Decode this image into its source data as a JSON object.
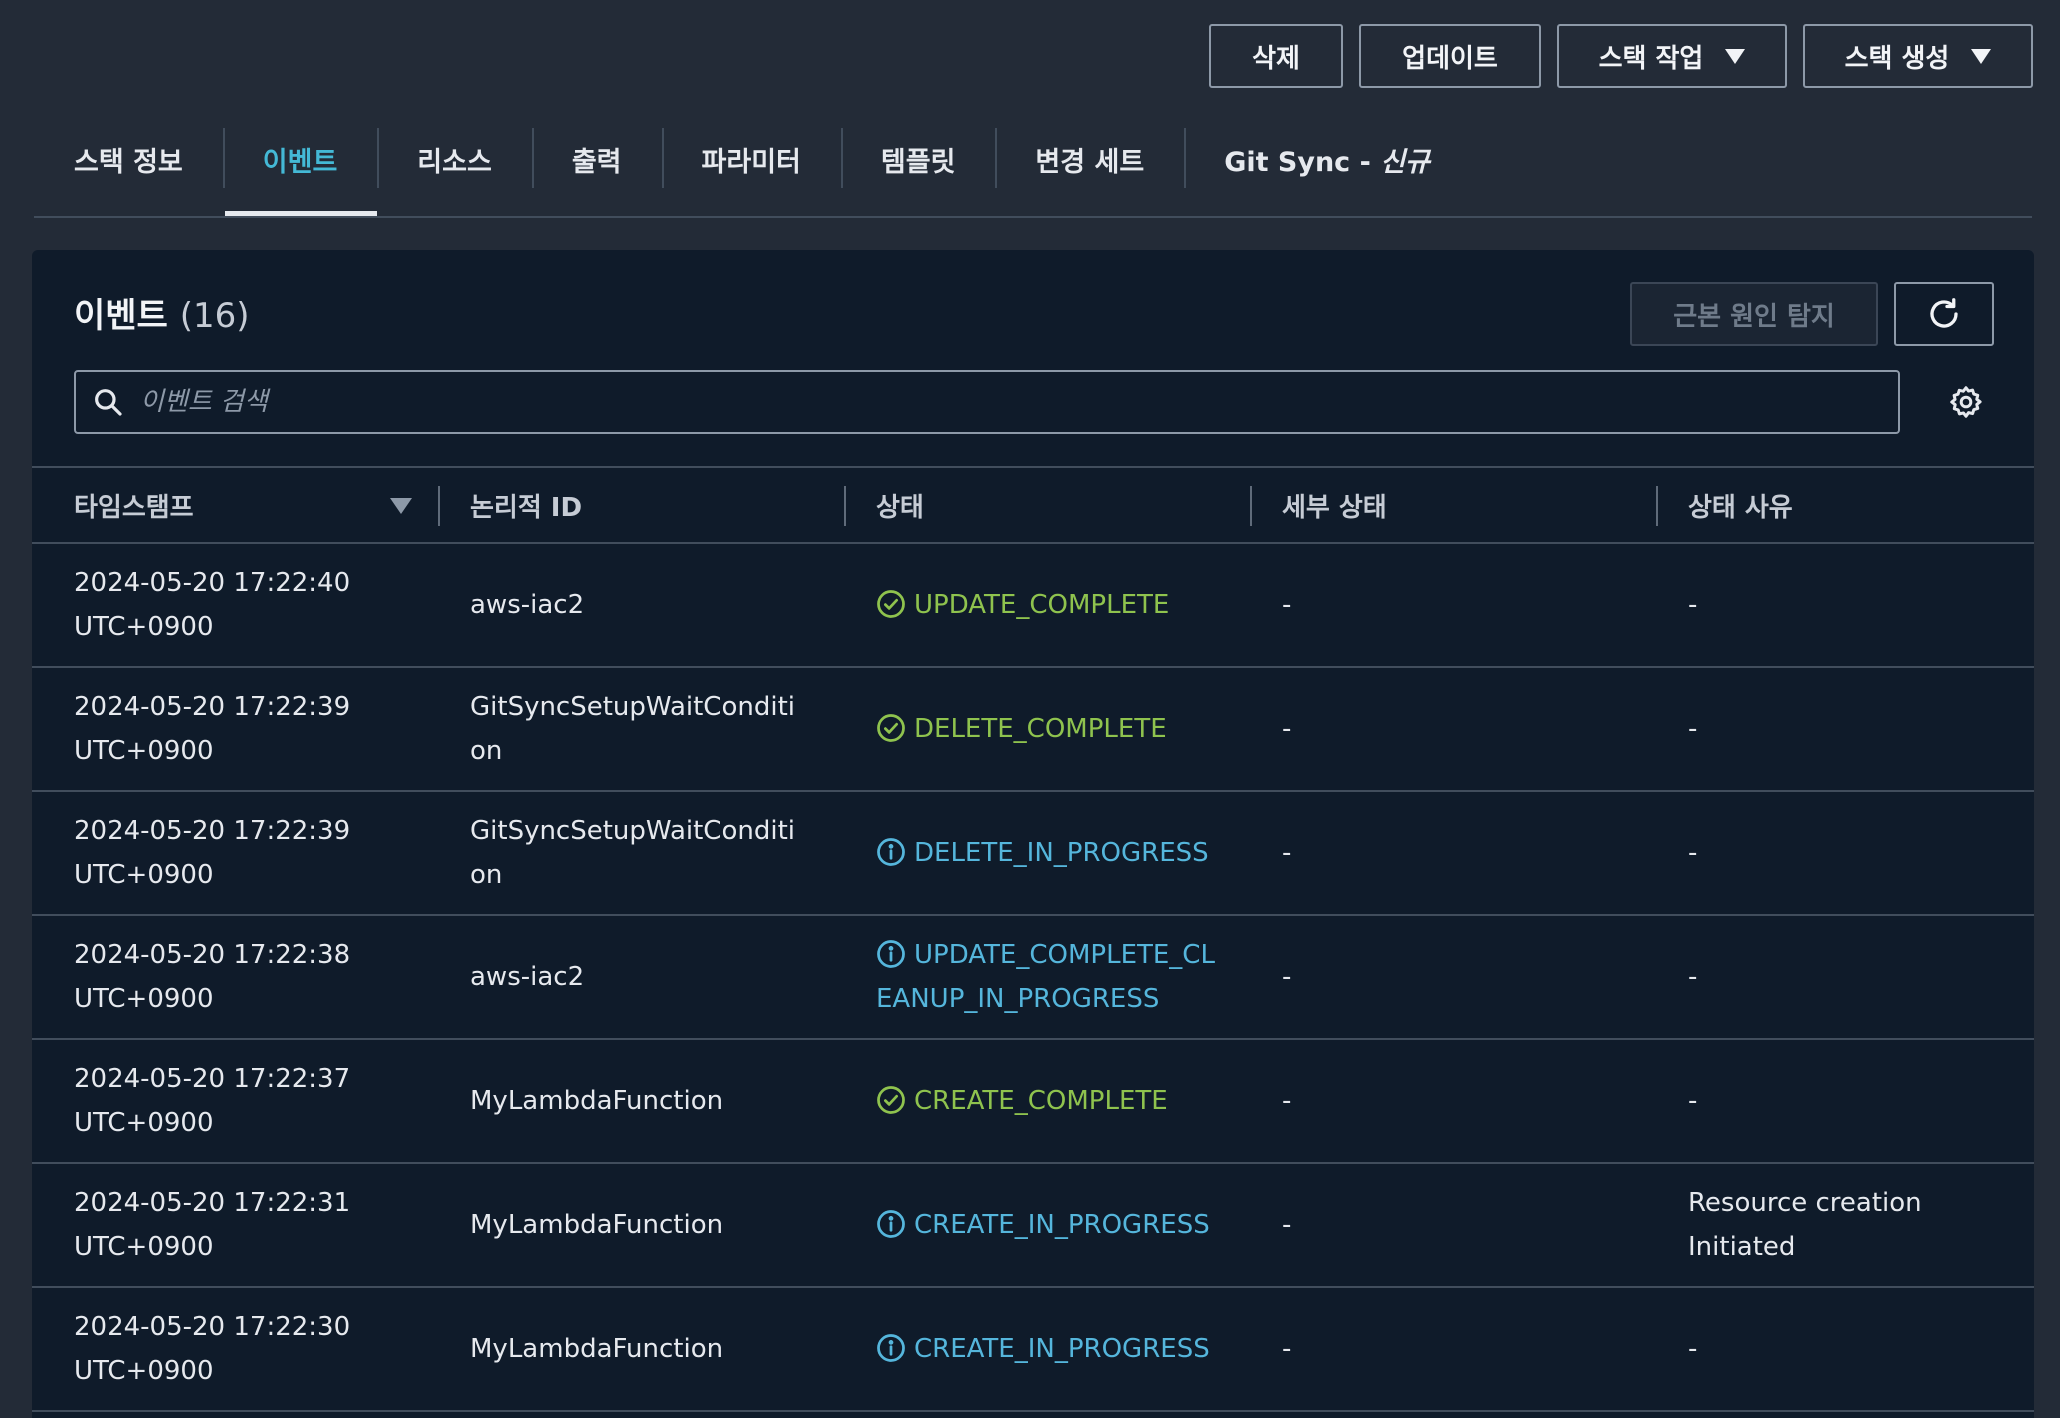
{
  "toolbar": {
    "delete_label": "삭제",
    "update_label": "업데이트",
    "stack_action_label": "스택 작업",
    "create_stack_label": "스택 생성"
  },
  "tabs": [
    {
      "label": "스택 정보",
      "active": false
    },
    {
      "label": "이벤트",
      "active": true
    },
    {
      "label": "리소스",
      "active": false
    },
    {
      "label": "출력",
      "active": false
    },
    {
      "label": "파라미터",
      "active": false
    },
    {
      "label": "템플릿",
      "active": false
    },
    {
      "label": "변경 세트",
      "active": false
    },
    {
      "label": "Git Sync - ",
      "new_label": "신규",
      "active": false
    }
  ],
  "events_panel": {
    "title": "이벤트",
    "count": "(16)",
    "rca_button_label": "근본 원인 탐지",
    "search_placeholder": "이벤트 검색"
  },
  "table": {
    "headers": {
      "timestamp": "타임스탬프",
      "logical_id": "논리적 ID",
      "status": "상태",
      "detailed_status": "세부 상태",
      "status_reason": "상태 사유"
    },
    "rows": [
      {
        "timestamp": "2024-05-20 17:22:40\nUTC+0900",
        "logical_id": "aws-iac2",
        "status": "UPDATE_COMPLETE",
        "status_type": "success",
        "detailed_status": "-",
        "status_reason": "-"
      },
      {
        "timestamp": "2024-05-20 17:22:39\nUTC+0900",
        "logical_id": "GitSyncSetupWaitCondition",
        "status": "DELETE_COMPLETE",
        "status_type": "success",
        "detailed_status": "-",
        "status_reason": "-"
      },
      {
        "timestamp": "2024-05-20 17:22:39\nUTC+0900",
        "logical_id": "GitSyncSetupWaitCondition",
        "status": "DELETE_IN_PROGRESS",
        "status_type": "info",
        "detailed_status": "-",
        "status_reason": "-"
      },
      {
        "timestamp": "2024-05-20 17:22:38\nUTC+0900",
        "logical_id": "aws-iac2",
        "status": "UPDATE_COMPLETE_CLEANUP_IN_PROGRESS",
        "status_type": "info",
        "detailed_status": "-",
        "status_reason": "-"
      },
      {
        "timestamp": "2024-05-20 17:22:37\nUTC+0900",
        "logical_id": "MyLambdaFunction",
        "status": "CREATE_COMPLETE",
        "status_type": "success",
        "detailed_status": "-",
        "status_reason": "-"
      },
      {
        "timestamp": "2024-05-20 17:22:31\nUTC+0900",
        "logical_id": "MyLambdaFunction",
        "status": "CREATE_IN_PROGRESS",
        "status_type": "info",
        "detailed_status": "-",
        "status_reason": "Resource creation Initiated"
      },
      {
        "timestamp": "2024-05-20 17:22:30\nUTC+0900",
        "logical_id": "MyLambdaFunction",
        "status": "CREATE_IN_PROGRESS",
        "status_type": "info",
        "detailed_status": "-",
        "status_reason": "-"
      }
    ]
  },
  "colors": {
    "background": "#232b37",
    "panel": "#0f1b2a",
    "active_tab": "#44b9d6",
    "success": "#8fc34e",
    "info": "#55b6dc"
  },
  "icons": {
    "success": "check-circle-icon",
    "info": "info-circle-icon",
    "search": "search-icon",
    "refresh": "refresh-icon",
    "settings": "gear-icon",
    "dropdown": "caret-down-icon",
    "sort": "sort-descending-icon"
  }
}
